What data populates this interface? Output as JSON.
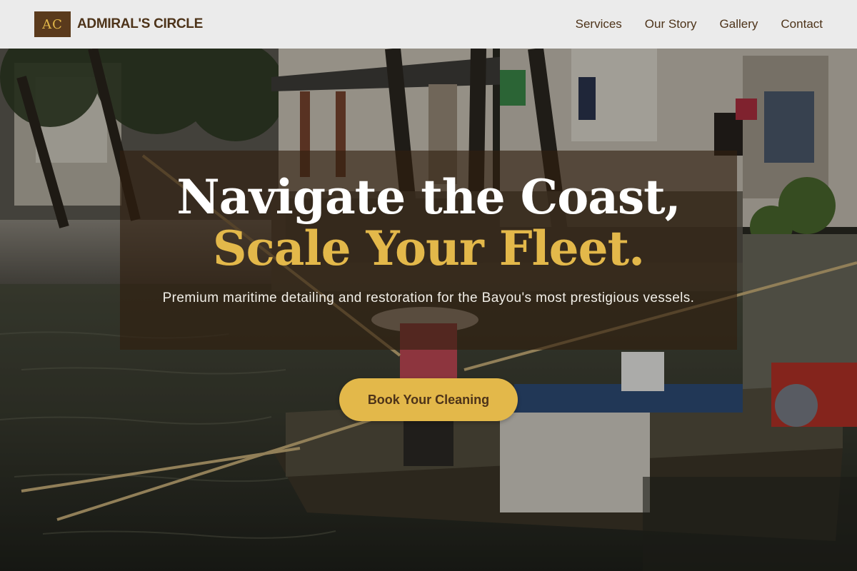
{
  "brand": {
    "logo_text": "AC",
    "name": "ADMIRAL'S CIRCLE"
  },
  "nav": {
    "items": [
      {
        "label": "Services"
      },
      {
        "label": "Our Story"
      },
      {
        "label": "Gallery"
      },
      {
        "label": "Contact"
      }
    ]
  },
  "hero": {
    "headline_line1": "Navigate the Coast,",
    "headline_line2": "Scale Your Fleet.",
    "subtitle": "Premium maritime detailing and restoration for the Bayou's most prestigious vessels.",
    "cta_label": "Book Your Cleaning",
    "background_description_icon": "canal-boat-photo"
  },
  "colors": {
    "accent_gold": "#e3b84a",
    "brand_brown": "#4d3319",
    "logo_bg": "#5a3a1c",
    "header_bg": "#ebebeb"
  }
}
